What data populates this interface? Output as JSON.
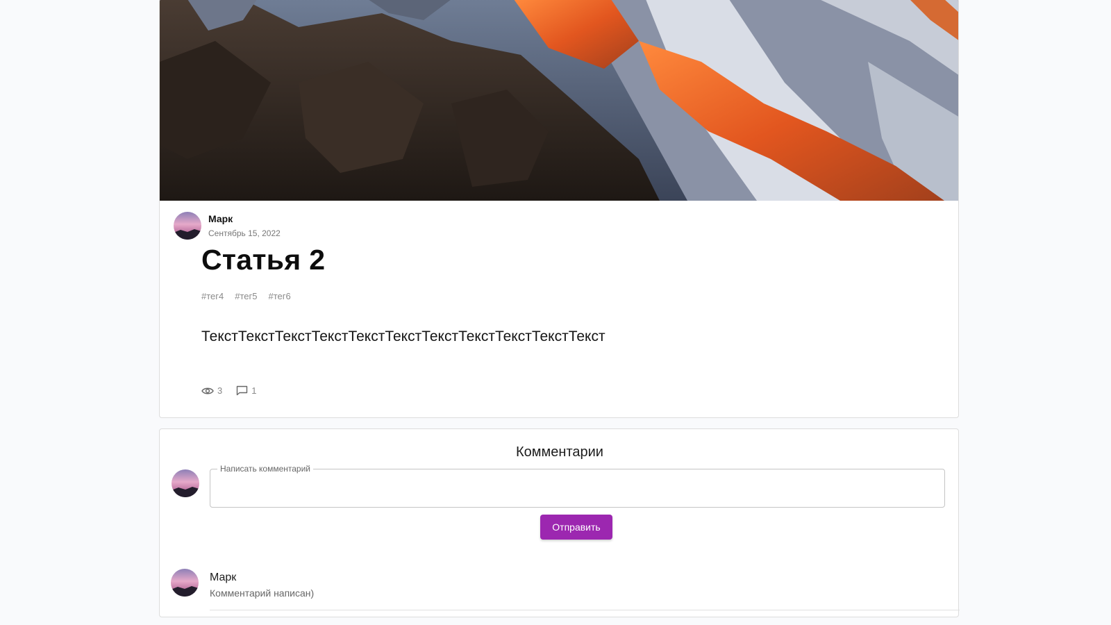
{
  "post": {
    "author": {
      "name": "Марк",
      "date": "Сентябрь 15, 2022"
    },
    "title": "Статья 2",
    "tags": [
      "#тег4",
      "#тег5",
      "#тег6"
    ],
    "body": "ТекстТекстТекстТекстТекстТекстТекстТекстТекстТекстТекст",
    "stats": {
      "views": "3",
      "comments": "1"
    },
    "hero_icon": "mountain-photo"
  },
  "comments": {
    "heading": "Комментарии",
    "input": {
      "label": "Написать комментарий",
      "value": ""
    },
    "submit_label": "Отправить",
    "items": [
      {
        "author": "Марк",
        "text": "Комментарий написан)"
      }
    ]
  },
  "colors": {
    "accent": "#9c27b0",
    "background": "#f9fafc",
    "card": "#ffffff",
    "border": "#dcdcdc"
  }
}
